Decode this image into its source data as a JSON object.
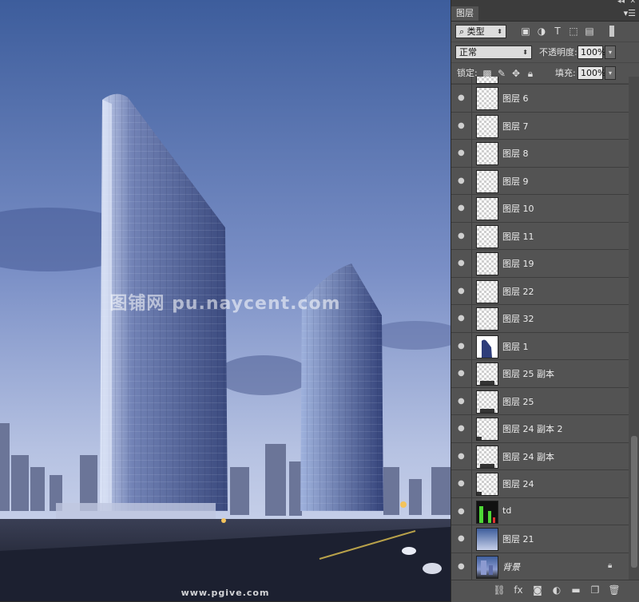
{
  "canvas": {
    "watermark": "图铺网 pu.naycent.com",
    "bottom_watermark": "www.pgive.com"
  },
  "panel": {
    "tab_label": "图层",
    "filter": {
      "label": "类型",
      "icon": "search-icon"
    },
    "filter_tools": [
      "image-filter-icon",
      "adjustment-filter-icon",
      "type-filter-icon",
      "shape-filter-icon",
      "smart-object-filter-icon",
      "filter-toggle-icon"
    ],
    "blend_mode": "正常",
    "opacity_label": "不透明度:",
    "opacity_value": "100%",
    "lock_label": "锁定:",
    "lock_tools": [
      "lock-transparent-icon",
      "lock-paint-icon",
      "lock-position-icon",
      "lock-all-icon"
    ],
    "fill_label": "填充:",
    "fill_value": "100%"
  },
  "layers": [
    {
      "name": "",
      "thumb": "transparent",
      "partial": true
    },
    {
      "name": "图层 6",
      "thumb": "transparent"
    },
    {
      "name": "图层 7",
      "thumb": "transparent"
    },
    {
      "name": "图层 8",
      "thumb": "transparent"
    },
    {
      "name": "图层 9",
      "thumb": "transparent"
    },
    {
      "name": "图层 10",
      "thumb": "transparent"
    },
    {
      "name": "图层 11",
      "thumb": "transparent"
    },
    {
      "name": "图层 19",
      "thumb": "transparent"
    },
    {
      "name": "图层 22",
      "thumb": "transparent"
    },
    {
      "name": "图层 32",
      "thumb": "transparent"
    },
    {
      "name": "图层 1",
      "thumb": "building"
    },
    {
      "name": "图层 25 副本",
      "thumb": "transparent-bottom"
    },
    {
      "name": "图层 25",
      "thumb": "transparent-bottom"
    },
    {
      "name": "图层 24 副本 2",
      "thumb": "transparent-corner"
    },
    {
      "name": "图层 24 副本",
      "thumb": "transparent-bottom"
    },
    {
      "name": "图层 24",
      "thumb": "transparent-corner"
    },
    {
      "name": "td",
      "thumb": "green"
    },
    {
      "name": "图层 21",
      "thumb": "sky"
    },
    {
      "name": "背景",
      "thumb": "photo",
      "locked": true
    }
  ],
  "bottom_tools": [
    "link-layers-icon",
    "fx-icon",
    "add-mask-icon",
    "adjustment-layer-icon",
    "new-group-icon",
    "new-layer-icon",
    "delete-layer-icon"
  ],
  "colors": {
    "panel_bg": "#535353",
    "sky_top": "#3f5f9d",
    "sky_bottom": "#c9d3ea"
  }
}
